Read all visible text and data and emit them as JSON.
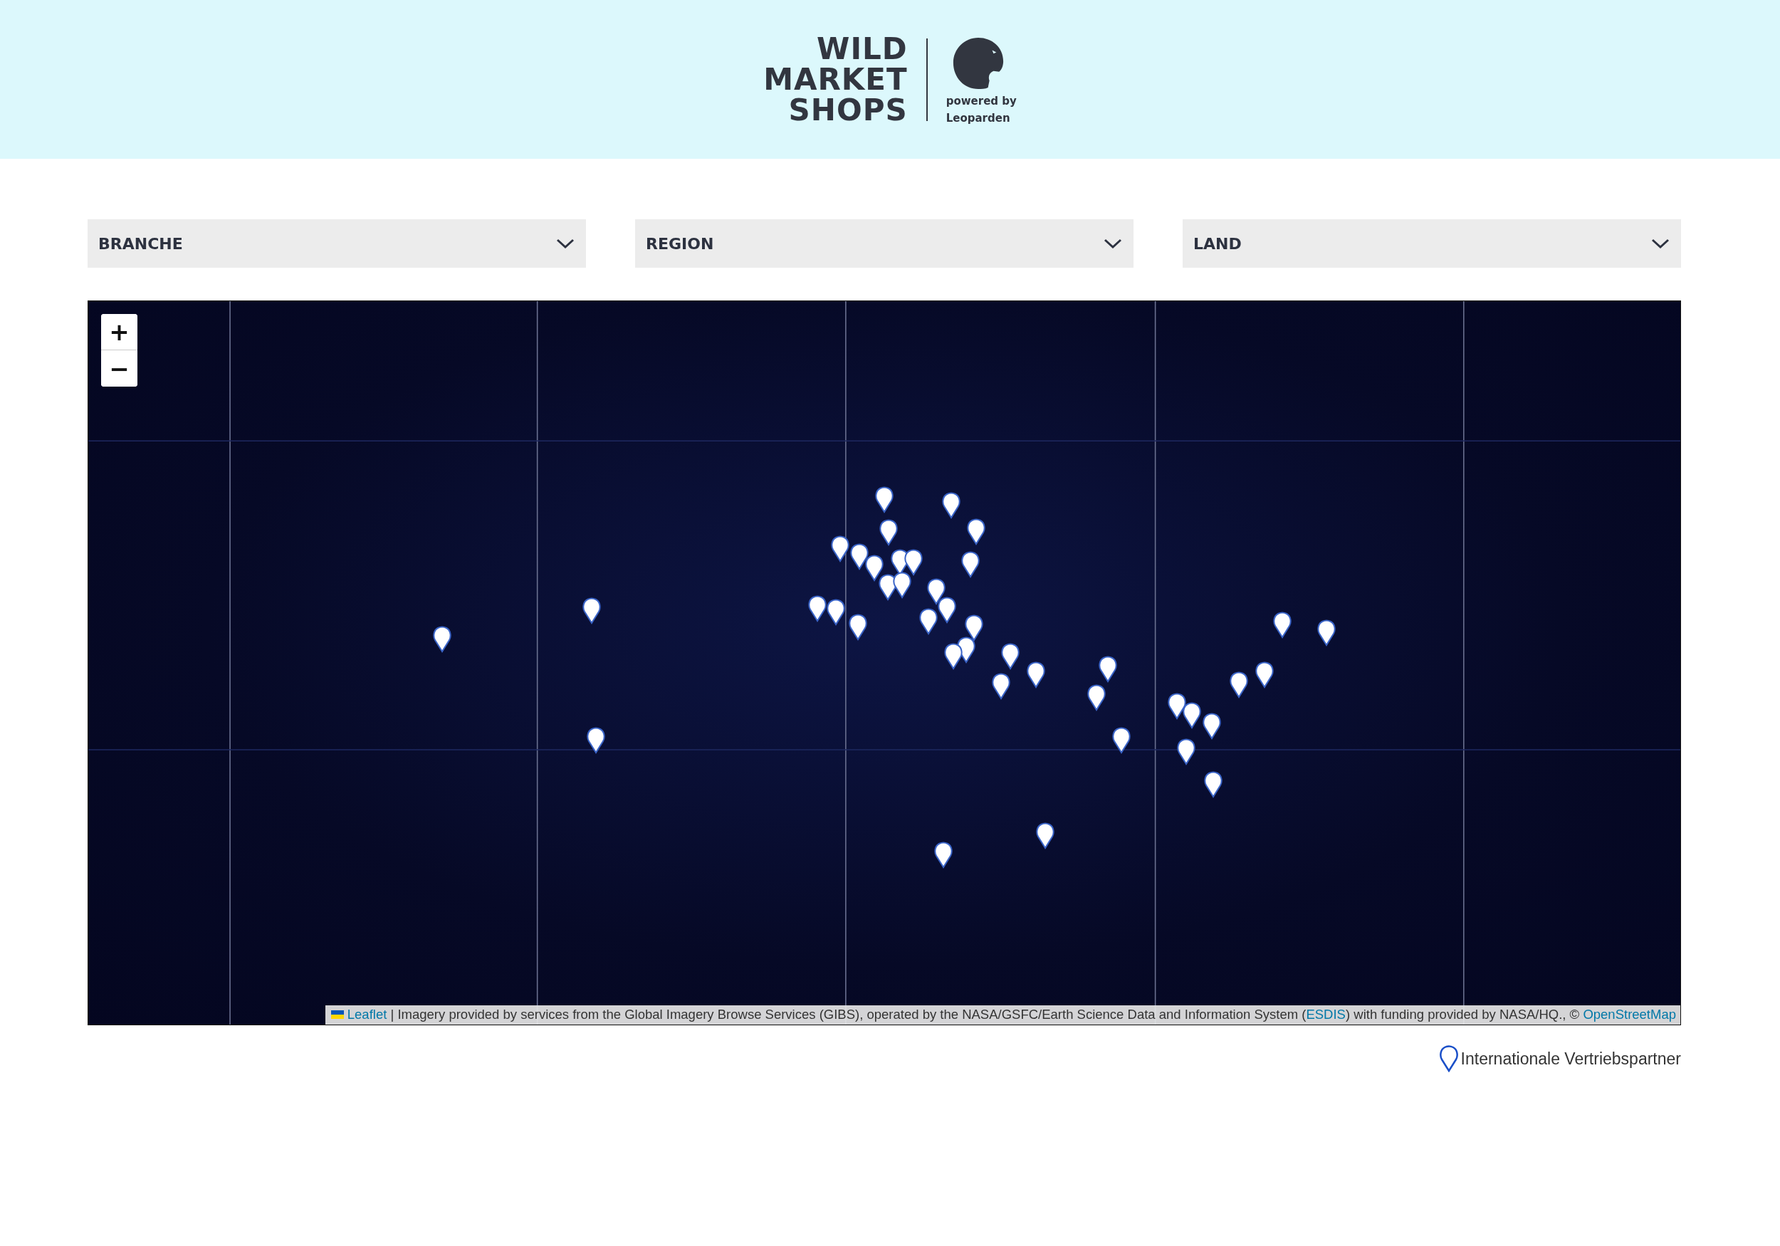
{
  "header": {
    "logo_lines": [
      "WILD",
      "MARKET",
      "SHOPS"
    ],
    "powered_by": [
      "powered by",
      "Leoparden"
    ]
  },
  "filters": [
    {
      "label": "BRANCHE"
    },
    {
      "label": "REGION"
    },
    {
      "label": "LAND"
    }
  ],
  "map": {
    "zoom_in": "+",
    "zoom_out": "−",
    "attribution": {
      "leaflet_link": "Leaflet",
      "text_before": "| Imagery provided by services from the Global Imagery Browse Services (GIBS), operated by the NASA/GSFC/Earth Science Data and Information System (",
      "esdis_link": "ESDIS",
      "text_after": ") with funding provided by NASA/HQ., ©",
      "osm_link": "OpenStreetMap"
    }
  },
  "legend": {
    "label": "Internationale Vertriebspartner"
  }
}
